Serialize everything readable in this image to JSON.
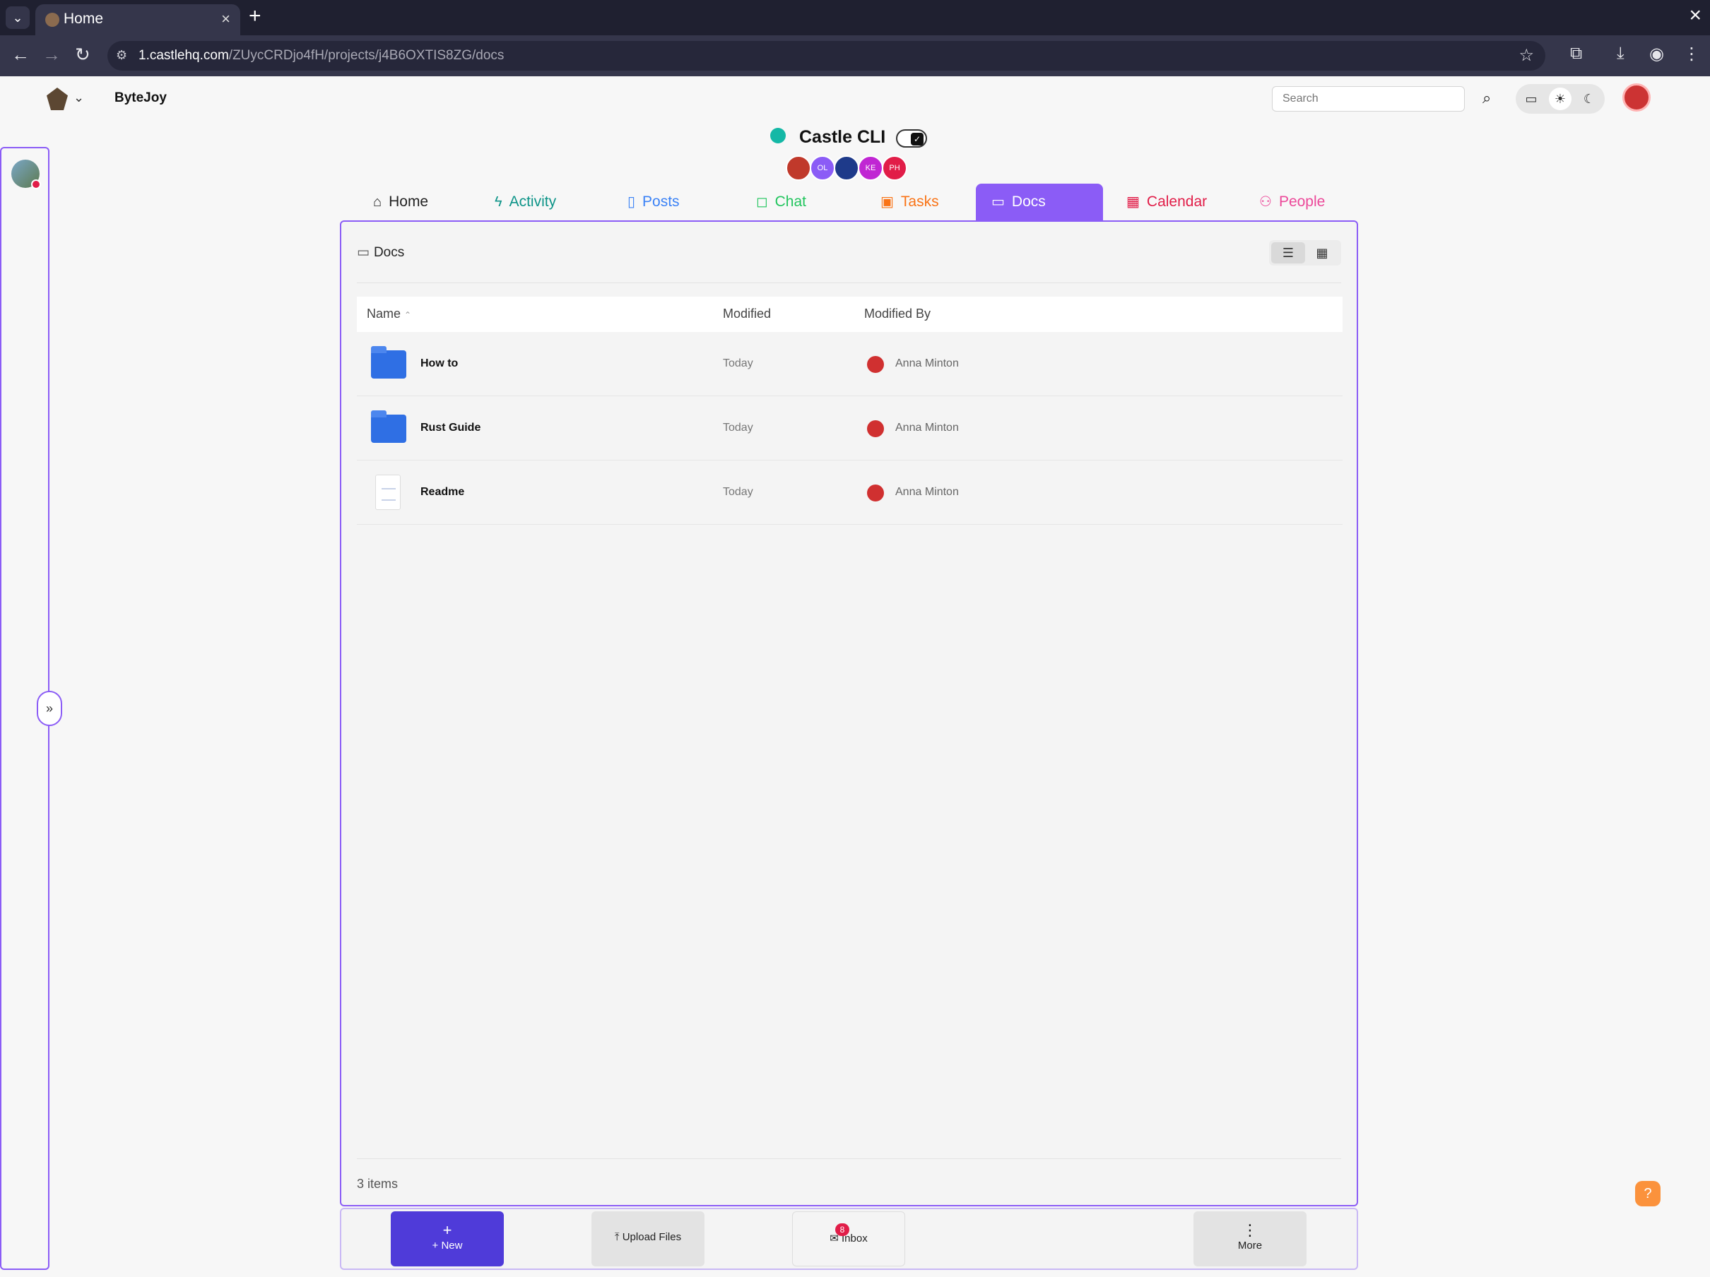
{
  "browser": {
    "tab_title": "Home",
    "url_host": "1.castlehq.com",
    "url_path": "/ZUycCRDjo4fH/projects/j4B6OXTIS8ZG/docs"
  },
  "header": {
    "org_name": "ByteJoy",
    "search_placeholder": "Search"
  },
  "project": {
    "title": "Castle CLI",
    "status_color": "#14b8a6",
    "members": [
      {
        "initials": "",
        "color": "#c0392b"
      },
      {
        "initials": "OL",
        "color": "#8b5cf6"
      },
      {
        "initials": "",
        "color": "#1e3a8a"
      },
      {
        "initials": "KE",
        "color": "#c026d3"
      },
      {
        "initials": "PH",
        "color": "#e11d48"
      }
    ]
  },
  "tabs": [
    {
      "label": "Home",
      "icon": "home-icon",
      "color": "#222222"
    },
    {
      "label": "Activity",
      "icon": "bolt-icon",
      "color": "#0d9488"
    },
    {
      "label": "Posts",
      "icon": "document-icon",
      "color": "#3b82f6"
    },
    {
      "label": "Chat",
      "icon": "chat-icon",
      "color": "#22c55e"
    },
    {
      "label": "Tasks",
      "icon": "clipboard-icon",
      "color": "#f97316"
    },
    {
      "label": "Docs",
      "icon": "folder-icon",
      "color": "#8b5cf6"
    },
    {
      "label": "Calendar",
      "icon": "calendar-icon",
      "color": "#e11d48"
    },
    {
      "label": "People",
      "icon": "people-icon",
      "color": "#ec4899"
    }
  ],
  "docs": {
    "breadcrumb": "Docs",
    "columns": {
      "name": "Name",
      "modified": "Modified",
      "modified_by": "Modified By"
    },
    "rows": [
      {
        "type": "folder",
        "name": "How to",
        "modified": "Today",
        "modified_by": "Anna Minton"
      },
      {
        "type": "folder",
        "name": "Rust Guide",
        "modified": "Today",
        "modified_by": "Anna Minton"
      },
      {
        "type": "document",
        "name": "Readme",
        "modified": "Today",
        "modified_by": "Anna Minton"
      }
    ],
    "item_count": "3 items"
  },
  "toolbar": {
    "new_label": "+ New",
    "upload_label": "Upload Files",
    "inbox_label": "Inbox",
    "inbox_badge": "8",
    "more_label": "More"
  },
  "help_label": "?"
}
